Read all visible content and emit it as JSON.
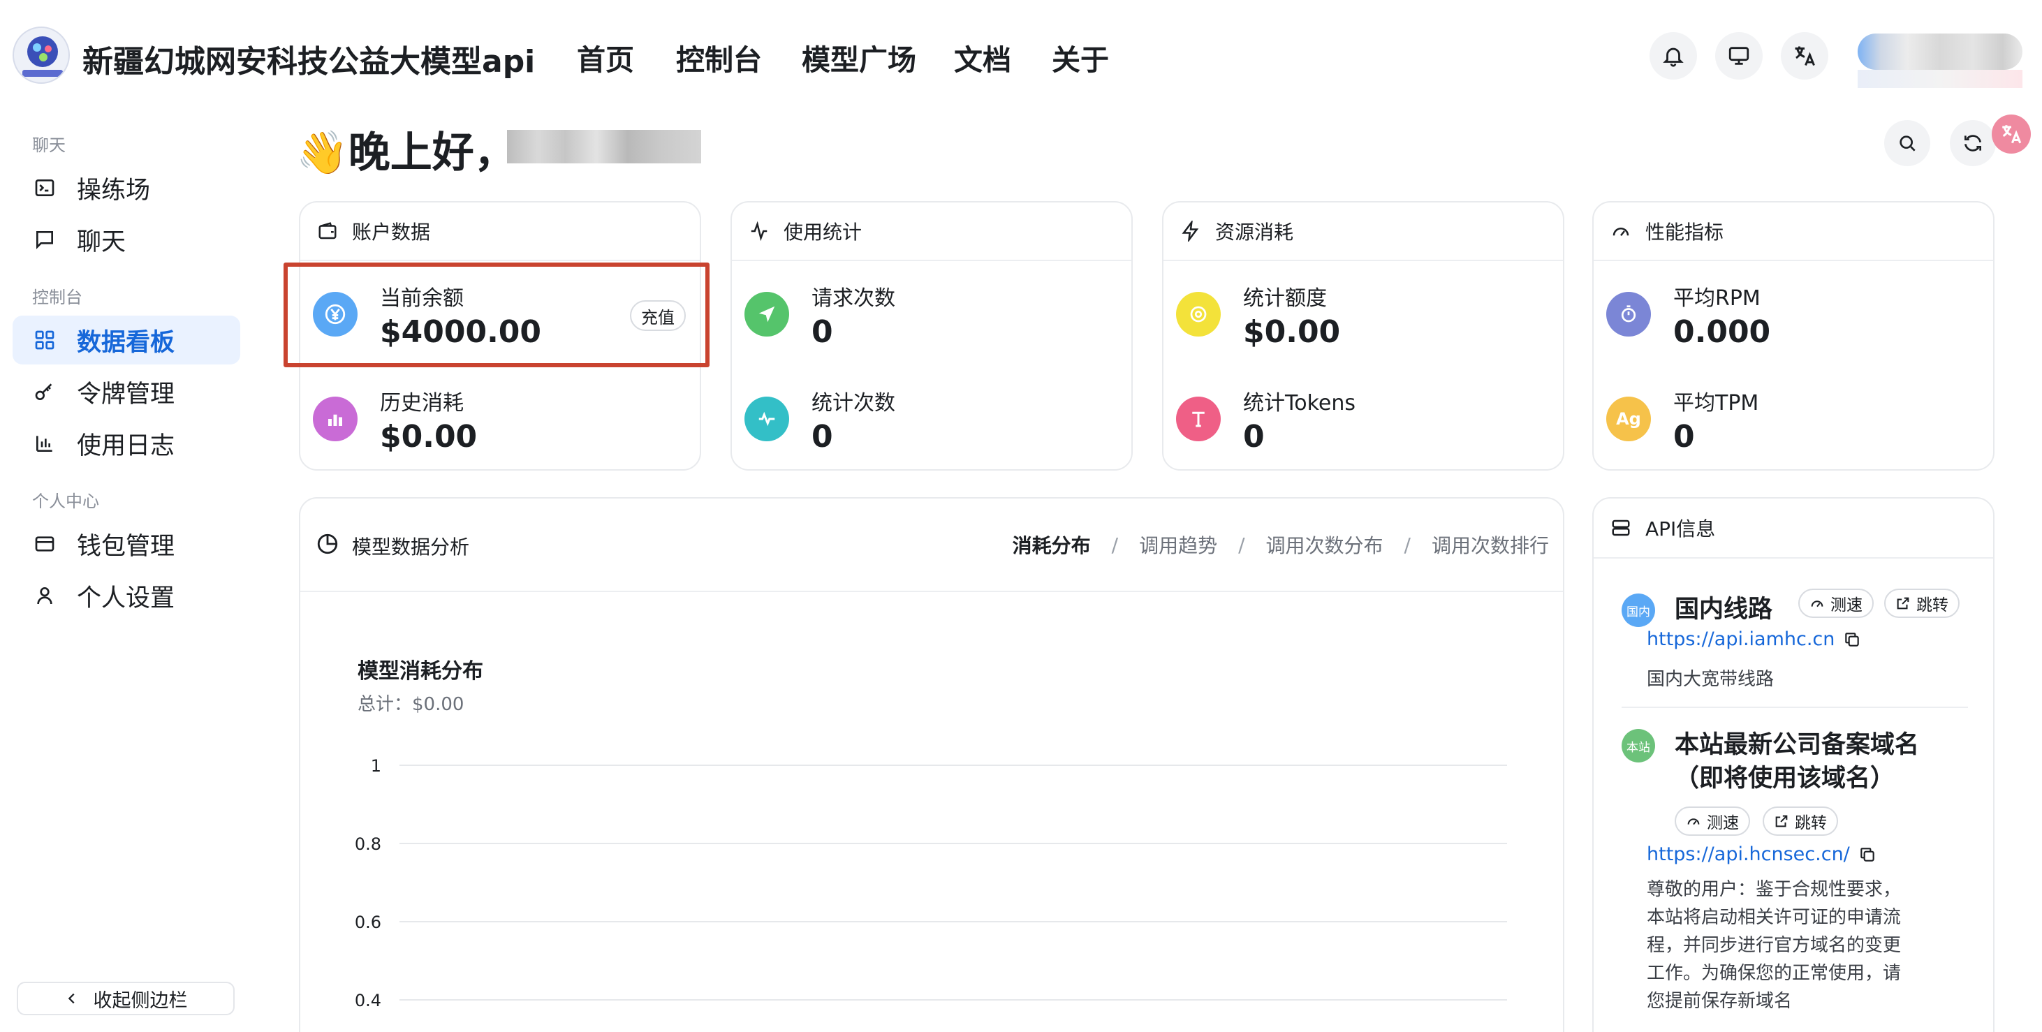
{
  "header": {
    "site_title": "新疆幻城网安科技公益大模型api",
    "nav": [
      "首页",
      "控制台",
      "模型广场",
      "文档",
      "关于"
    ],
    "icons": [
      "bell-icon",
      "monitor-icon",
      "translate-icon"
    ]
  },
  "sidebar": {
    "groups": {
      "chat": "聊天",
      "console": "控制台",
      "personal": "个人中心"
    },
    "items": [
      {
        "label": "操练场",
        "icon": "terminal-icon"
      },
      {
        "label": "聊天",
        "icon": "chat-bubble-icon"
      },
      {
        "label": "数据看板",
        "icon": "dashboard-grid-icon",
        "active": true
      },
      {
        "label": "令牌管理",
        "icon": "key-icon"
      },
      {
        "label": "使用日志",
        "icon": "bar-chart-icon"
      },
      {
        "label": "钱包管理",
        "icon": "wallet-icon"
      },
      {
        "label": "个人设置",
        "icon": "user-icon"
      }
    ],
    "collapse_label": "收起侧边栏"
  },
  "greeting": {
    "text": "👋晚上好，"
  },
  "cards": [
    {
      "title": "账户数据",
      "icon": "wallet-icon",
      "metrics": [
        {
          "label": "当前余额",
          "value": "$4000.00",
          "color": "#5aa8f5",
          "glyph": "¥"
        },
        {
          "label": "历史消耗",
          "value": "$0.00",
          "color": "#c96bd6",
          "glyph": "▮"
        }
      ],
      "action": "充值"
    },
    {
      "title": "使用统计",
      "icon": "activity-icon",
      "metrics": [
        {
          "label": "请求次数",
          "value": "0",
          "color": "#55c46b",
          "glyph": "➤"
        },
        {
          "label": "统计次数",
          "value": "0",
          "color": "#33bfc7",
          "glyph": "∿"
        }
      ]
    },
    {
      "title": "资源消耗",
      "icon": "lightning-icon",
      "metrics": [
        {
          "label": "统计额度",
          "value": "$0.00",
          "color": "#f3e23a",
          "glyph": "◎"
        },
        {
          "label": "统计Tokens",
          "value": "0",
          "color": "#ef5f86",
          "glyph": "T"
        }
      ]
    },
    {
      "title": "性能指标",
      "icon": "gauge-icon",
      "metrics": [
        {
          "label": "平均RPM",
          "value": "0.000",
          "color": "#7b86d6",
          "glyph": "◷"
        },
        {
          "label": "平均TPM",
          "value": "0",
          "color": "#f6c24a",
          "glyph": "Ag"
        }
      ]
    }
  ],
  "analysis": {
    "title": "模型数据分析",
    "tabs": [
      "消耗分布",
      "调用趋势",
      "调用次数分布",
      "调用次数排行"
    ],
    "active_tab": "消耗分布",
    "chart_title": "模型消耗分布",
    "chart_total": "总计：$0.00",
    "chart_data": {
      "type": "bar",
      "title": "模型消耗分布",
      "categories": [],
      "series": [],
      "yticks": [
        "1",
        "0.8",
        "0.6",
        "0.4"
      ],
      "ylim": [
        0,
        1
      ],
      "grid": true
    }
  },
  "api_info": {
    "title": "API信息",
    "routes": [
      {
        "badge": "国内",
        "badge_color": "#5aa8f5",
        "title": "国内线路",
        "speed_label": "测速",
        "jump_label": "跳转",
        "url": "https://api.iamhc.cn",
        "desc": "国内大宽带线路"
      },
      {
        "badge": "本站",
        "badge_color": "#6cc27a",
        "title_line1": "本站最新公司备案域名",
        "title_line2": "（即将使用该域名）",
        "speed_label": "测速",
        "jump_label": "跳转",
        "url": "https://api.hcnsec.cn/",
        "notice_lines": [
          "尊敬的用户：鉴于合规性要求，",
          "本站将启动相关许可证的申请流",
          "程，并同步进行官方域名的变更",
          "工作。为确保您的正常使用，请",
          "您提前保存新域名"
        ]
      }
    ]
  }
}
